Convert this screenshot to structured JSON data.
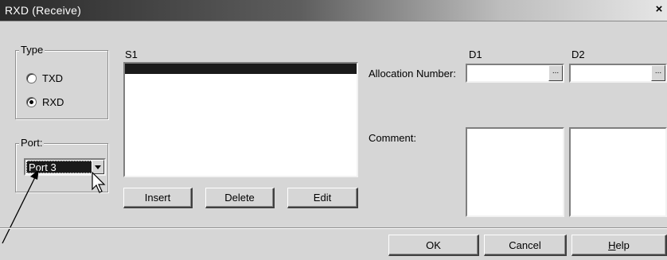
{
  "window": {
    "title": "RXD (Receive)",
    "close_glyph": "×"
  },
  "type_group": {
    "legend": "Type",
    "options": [
      {
        "label": "TXD",
        "selected": false
      },
      {
        "label": "RXD",
        "selected": true
      }
    ]
  },
  "port_group": {
    "legend": "Port:",
    "selected_value": "Port 3"
  },
  "s1": {
    "label": "S1",
    "buttons": {
      "insert": "Insert",
      "delete": "Delete",
      "edit": "Edit"
    }
  },
  "d1": {
    "label": "D1"
  },
  "d2": {
    "label": "D2"
  },
  "allocation": {
    "label": "Allocation Number:",
    "ellipsis": "..."
  },
  "comment": {
    "label": "Comment:"
  },
  "footer": {
    "ok": "OK",
    "cancel": "Cancel",
    "help_accel": "H",
    "help_rest": "elp"
  },
  "icons": [
    "close-icon",
    "radio-icon",
    "dropdown-arrow-icon",
    "ellipsis-icon",
    "mouse-pointer-icon",
    "callout-arrow"
  ]
}
